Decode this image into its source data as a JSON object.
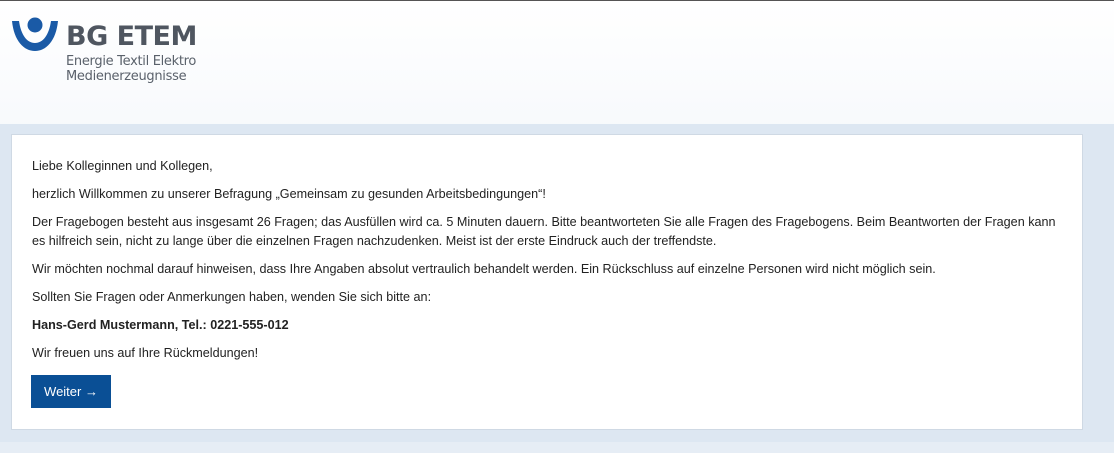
{
  "header": {
    "logo": {
      "title": "BG ETEM",
      "subtitle_line1": "Energie Textil Elektro",
      "subtitle_line2": "Medienerzeugnisse",
      "icon": "bg-etem-logo-mark",
      "brand_color": "#1a5aa6"
    }
  },
  "intro": {
    "greeting": "Liebe Kolleginnen und Kollegen,",
    "welcome": "herzlich Willkommen zu unserer Befragung „Gemeinsam zu gesunden Arbeitsbedingungen“!",
    "instructions": "Der Fragebogen besteht aus insgesamt 26 Fragen; das Ausfüllen wird ca. 5 Minuten dauern. Bitte beantworteten Sie alle Fragen des Fragebogens. Beim Beantworten der Fragen kann es hilfreich sein, nicht zu lange über die einzelnen Fragen nachzudenken. Meist ist der erste Eindruck auch der treffendste.",
    "confidentiality": "Wir möchten nochmal darauf hinweisen, dass Ihre Angaben absolut vertraulich behandelt werden. Ein Rückschluss auf einzelne Personen wird nicht möglich sein.",
    "contact_prompt": "Sollten Sie Fragen oder Anmerkungen haben, wenden Sie sich bitte an:",
    "contact": "Hans-Gerd Mustermann, Tel.: 0221-555-012",
    "closing": "Wir freuen uns auf Ihre Rückmeldungen!"
  },
  "actions": {
    "next_label": "Weiter →",
    "button_color": "#0a4f95"
  }
}
